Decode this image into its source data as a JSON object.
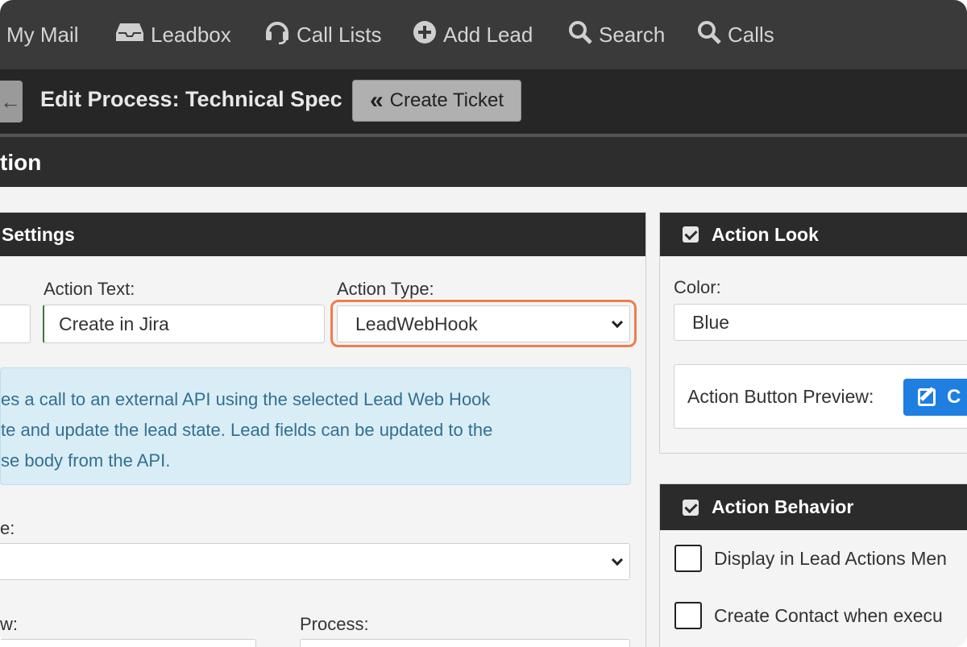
{
  "topnav": {
    "items": [
      {
        "label": "My Mail",
        "icon": "mail-icon"
      },
      {
        "label": "Leadbox",
        "icon": "inbox-icon"
      },
      {
        "label": "Call Lists",
        "icon": "headset-icon"
      },
      {
        "label": "Add Lead",
        "icon": "plus-circle-icon"
      },
      {
        "label": "Search",
        "icon": "search-icon"
      },
      {
        "label": "Calls",
        "icon": "search-icon"
      }
    ]
  },
  "titlebar": {
    "title": "Edit Process: Technical Spec",
    "create_ticket_label": "Create Ticket",
    "create_ticket_icon": "double-chevron-left-icon"
  },
  "section": {
    "title": "tion"
  },
  "settings": {
    "header": "Settings",
    "action_text_label": "Action Text:",
    "action_text_value": "Create in Jira",
    "action_type_label": "Action Type:",
    "action_type_value": "LeadWebHook",
    "info_lines": [
      "es a call to an external API using the selected Lead Web Hook",
      "te and update the lead state. Lead fields can be updated to the",
      "se body from the API."
    ],
    "e_label": "e:",
    "w_label": "w:",
    "process_label": "Process:"
  },
  "action_look": {
    "header": "Action Look",
    "color_label": "Color:",
    "color_value": "Blue",
    "preview_label": "Action Button Preview:",
    "preview_button_text": "C"
  },
  "action_behavior": {
    "header": "Action Behavior",
    "option1": "Display in Lead Actions Men",
    "option2": "Create Contact when execu"
  },
  "colors": {
    "nav_bg": "#3a3a3a",
    "title_bg": "#262626",
    "panel_head_bg": "#2b2b2b",
    "info_bg": "#d9edf7",
    "info_text": "#31708f",
    "highlight": "#f07c4c",
    "primary_button": "#1e7fe0"
  }
}
